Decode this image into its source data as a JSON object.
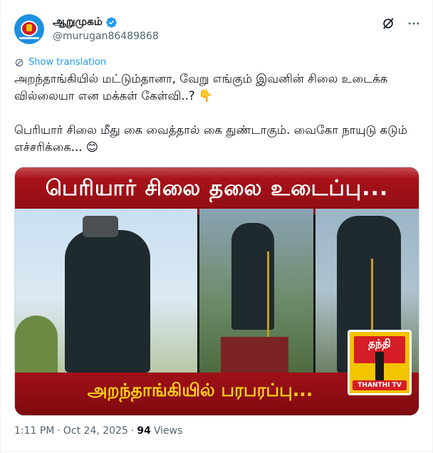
{
  "author": {
    "display_name": "ஆறுமுகம்",
    "handle": "@murugan86489868",
    "verified": true,
    "avatar_colors": {
      "bg": "#1d8fe0",
      "ring": "#c8202a",
      "core": "#f2c200"
    }
  },
  "actions": {
    "grok_icon": "grok-icon",
    "more_icon": "more-icon"
  },
  "translate_label": "Show translation",
  "tweet": {
    "line1": "அறந்தாங்கியில் மட்டும்தானா, வேறு எங்கும் இவனின் சிலை உடைக்க வில்லையா என மக்கள் கேள்வி..?",
    "emoji1": "👇",
    "line2": "பெரியார் சிலை மீது கை வைத்தால் கை துண்டாகும். வைகோ நாயுடு கடும் எச்சரிக்கை...",
    "emoji2": "😊"
  },
  "media": {
    "headline": "பெரியார் சிலை தலை உடைப்பு...",
    "subline": "அறந்தாங்கியில் பரபரப்பு...",
    "logo_title": "தந்தி",
    "logo_tag": "THANTHI TV",
    "colors": {
      "banner": "#b0141b",
      "subline": "#ffd21a",
      "logo": "#f3c400"
    }
  },
  "meta": {
    "time": "1:11 PM",
    "separator": "·",
    "date": "Oct 24, 2025",
    "views_count": "94",
    "views_label": "Views"
  }
}
